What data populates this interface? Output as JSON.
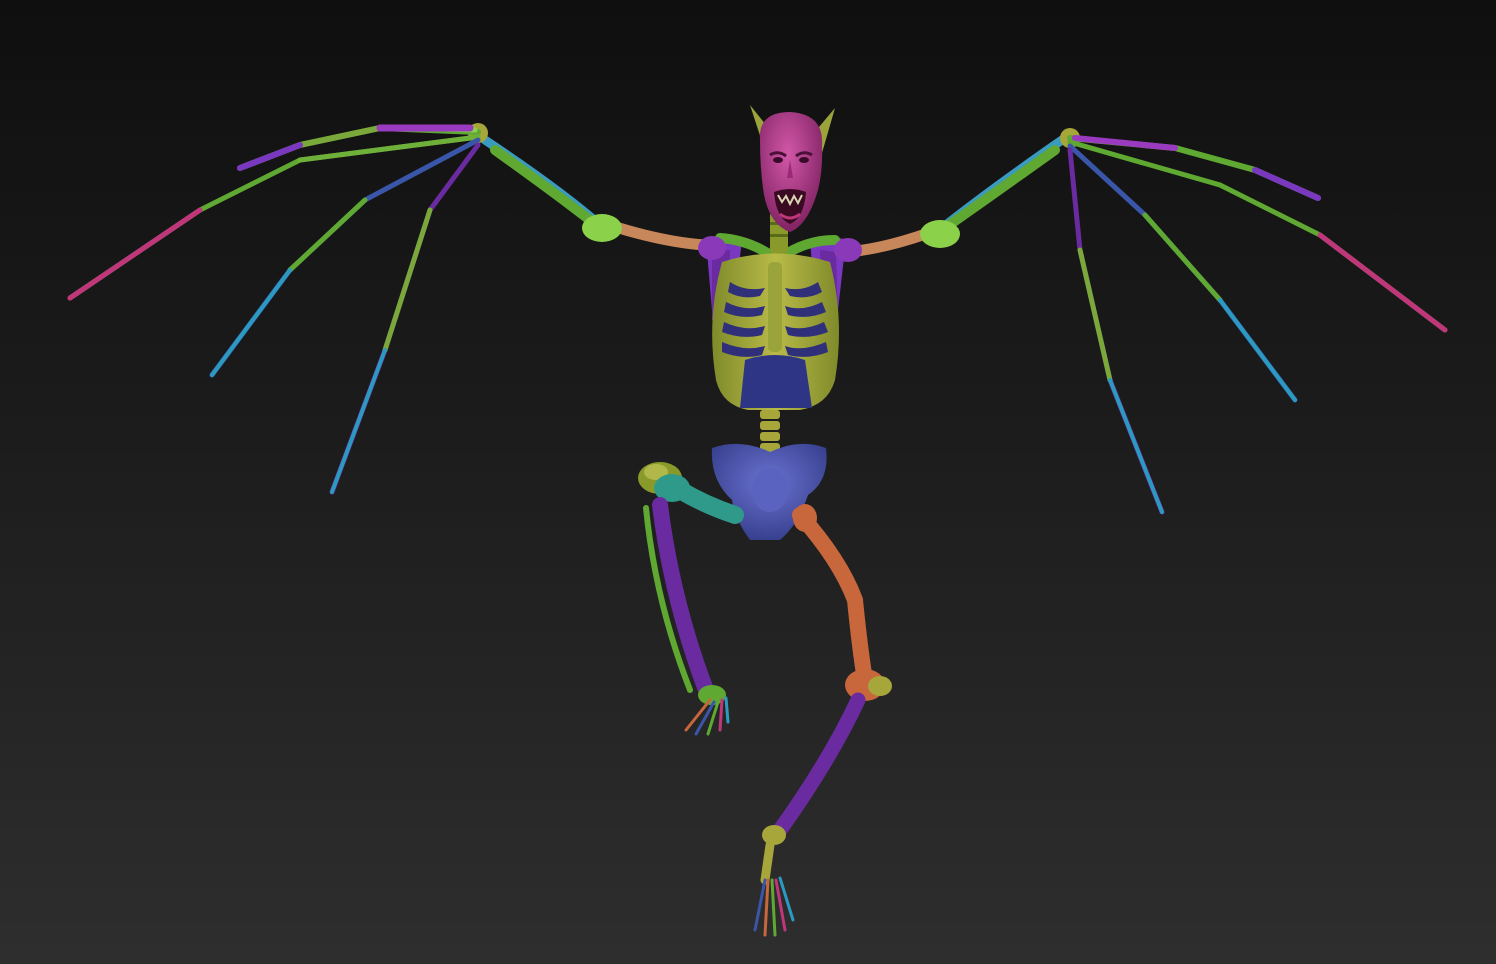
{
  "scene": {
    "background_top": "#0f0f0f",
    "background_bottom": "#2e2e2e",
    "colors": {
      "skull": "#b03a8e",
      "ear": "#9aa43a",
      "rib": "#a6a63a",
      "rib_gap": "#2f2f7a",
      "pelvis": "#4b55b0",
      "purple": "#6a2aa0",
      "green": "#5fa832",
      "lime": "#8bd14a",
      "teal": "#2f9a8a",
      "cyan": "#2a9ac0",
      "blue": "#3a56a8",
      "pink": "#c0367a",
      "orange": "#c8663c",
      "tan": "#c8875a",
      "olive": "#8a9a2a",
      "violet": "#7a38c0"
    }
  }
}
